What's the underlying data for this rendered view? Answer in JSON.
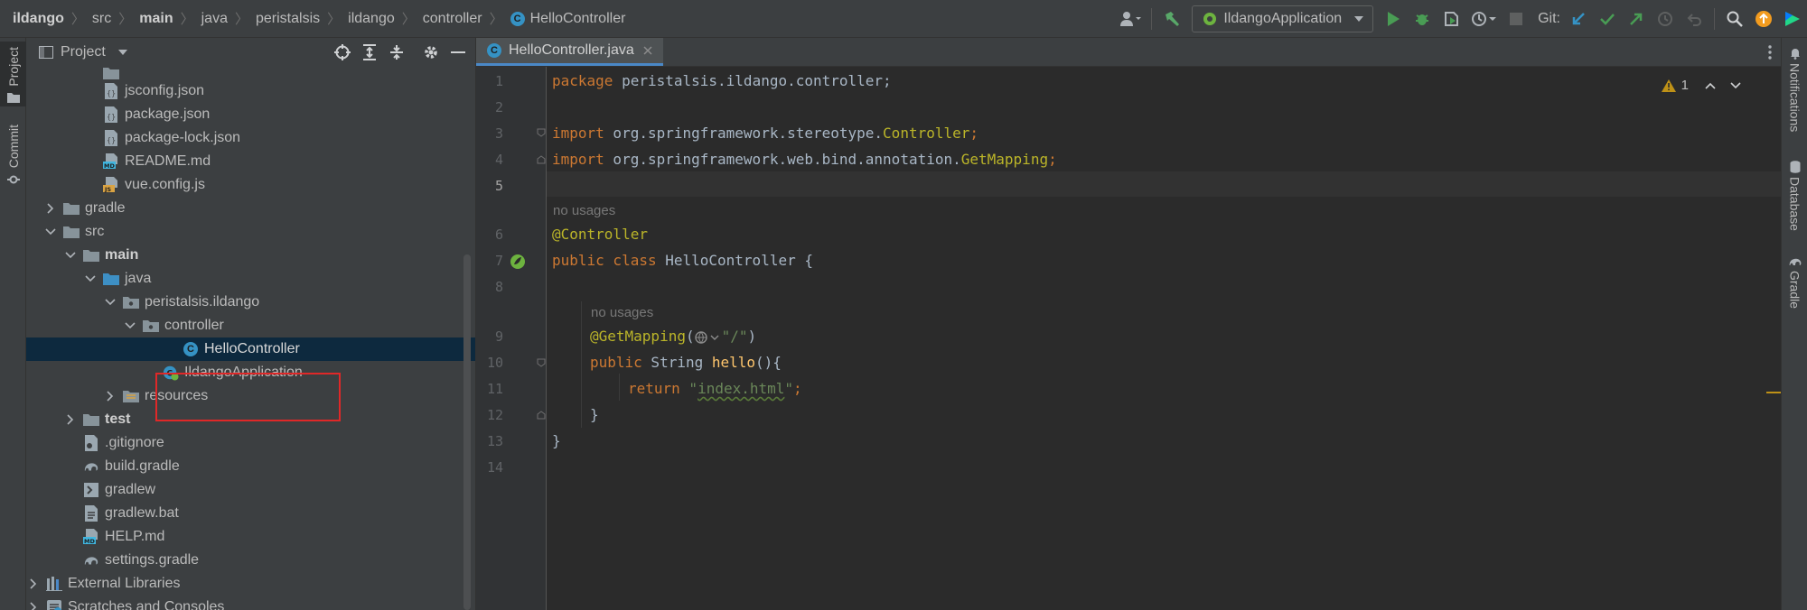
{
  "breadcrumb": [
    "ildango",
    "src",
    "main",
    "java",
    "peristalsis",
    "ildango",
    "controller",
    "HelloController"
  ],
  "toolbar": {
    "run_config": "IldangoApplication",
    "git_label": "Git:"
  },
  "left_strip": {
    "project_tab": "Project",
    "commit_tab": "Commit"
  },
  "right_strip": {
    "notifications": "Notifications",
    "database": "Database",
    "gradle": "Gradle"
  },
  "project_panel": {
    "title": "Project",
    "tree": [
      {
        "label": "jsconfig.json",
        "icon": "json-file-icon"
      },
      {
        "label": "package.json",
        "icon": "json-file-icon"
      },
      {
        "label": "package-lock.json",
        "icon": "json-file-icon"
      },
      {
        "label": "README.md",
        "icon": "markdown-file-icon"
      },
      {
        "label": "vue.config.js",
        "icon": "js-file-icon"
      },
      {
        "label": "gradle",
        "icon": "folder-icon"
      },
      {
        "label": "src",
        "icon": "folder-icon"
      },
      {
        "label": "main",
        "icon": "folder-icon"
      },
      {
        "label": "java",
        "icon": "source-folder-icon"
      },
      {
        "label": "peristalsis.ildango",
        "icon": "package-icon"
      },
      {
        "label": "controller",
        "icon": "package-icon"
      },
      {
        "label": "HelloController",
        "icon": "class-icon"
      },
      {
        "label": "IldangoApplication",
        "icon": "spring-app-icon"
      },
      {
        "label": "resources",
        "icon": "folder-icon"
      },
      {
        "label": "test",
        "icon": "folder-icon"
      },
      {
        "label": ".gitignore",
        "icon": "gitignore-file-icon"
      },
      {
        "label": "build.gradle",
        "icon": "gradle-file-icon"
      },
      {
        "label": "gradlew",
        "icon": "shell-file-icon"
      },
      {
        "label": "gradlew.bat",
        "icon": "bat-file-icon"
      },
      {
        "label": "HELP.md",
        "icon": "markdown-file-icon"
      },
      {
        "label": "settings.gradle",
        "icon": "gradle-file-icon"
      },
      {
        "label": "External Libraries",
        "icon": "libraries-icon"
      },
      {
        "label": "Scratches and Consoles",
        "icon": "scratches-icon"
      }
    ]
  },
  "editor": {
    "tab_label": "HelloController.java",
    "inspection_count": "1",
    "line_numbers": [
      "1",
      "2",
      "3",
      "4",
      "5",
      "6",
      "7",
      "8",
      "9",
      "10",
      "11",
      "12",
      "13",
      "14"
    ],
    "hint_no_usages": "no usages",
    "code": {
      "l1_kw": "package",
      "l1_rest": " peristalsis.ildango.controller;",
      "l3_kw": "import",
      "l3_path": " org.springframework.stereotype.",
      "l3_cls": "Controller",
      "l3_end": ";",
      "l4_kw": "import",
      "l4_path": " org.springframework.web.bind.annotation.",
      "l4_cls": "GetMapping",
      "l4_end": ";",
      "l6_ann": "@Controller",
      "l7_kw": "public class",
      "l7_rest": " HelloController {",
      "l9_ann": "@GetMapping",
      "l9_open": "(",
      "l9_str": "\"/\"",
      "l9_close": ")",
      "l10_kw": "public",
      "l10_type": " String ",
      "l10_fn": "hello",
      "l10_rest": "(){",
      "l11_kw": "return",
      "l11_q1": " \"",
      "l11_str": "index.html",
      "l11_q2": "\"",
      "l11_end": ";",
      "l12": "}",
      "l13": "}"
    }
  },
  "colors": {
    "keyword": "#cc7832",
    "annotation": "#bbb529",
    "string": "#6a8759",
    "method": "#ffc66d",
    "selection": "#0d293e",
    "highlight_box": "#e02828"
  }
}
